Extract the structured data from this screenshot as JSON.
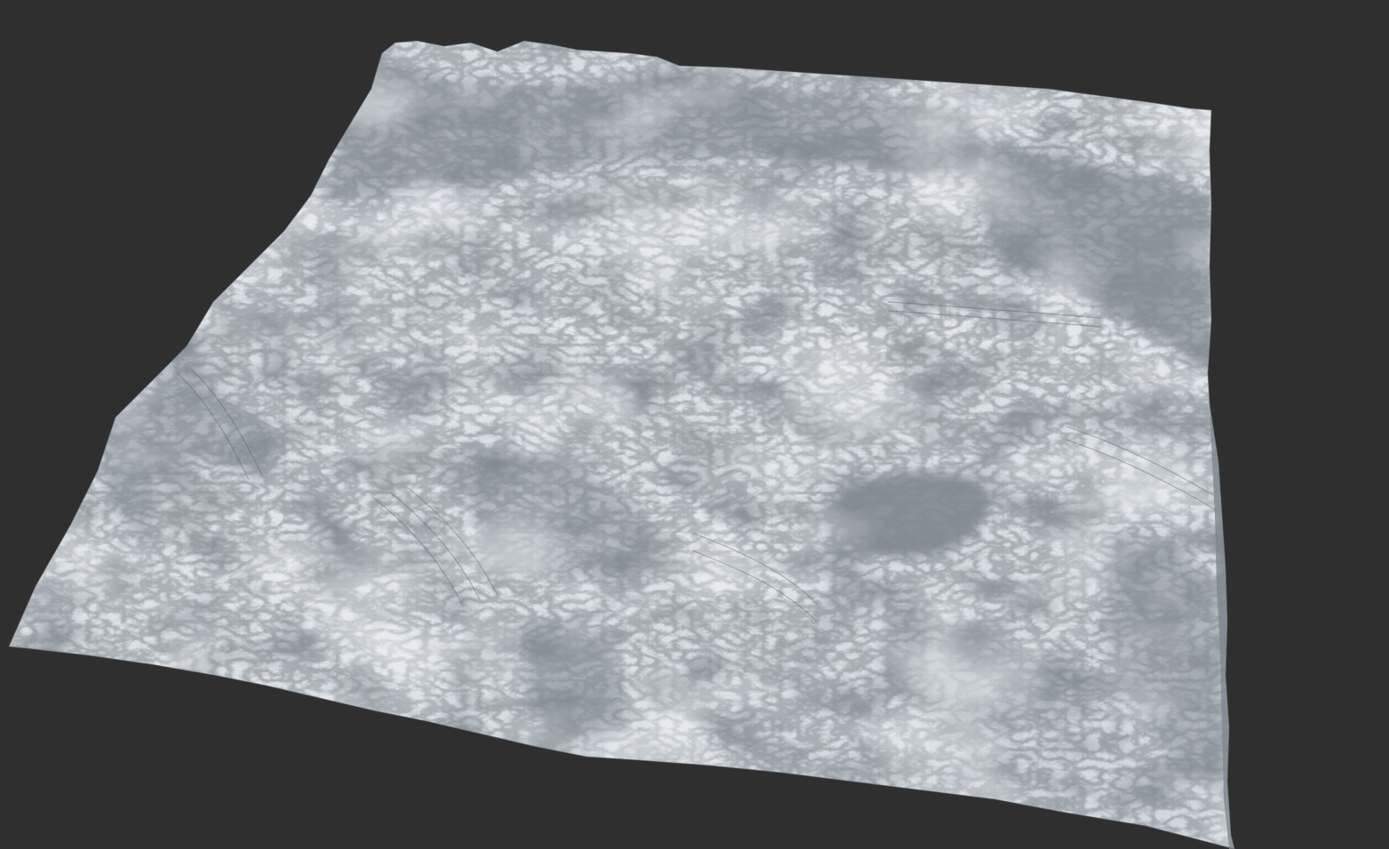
{
  "viewport": {
    "background_color": "#2f2f2f",
    "subject": "terrain-mesh",
    "terrain_colors": {
      "light": "#dfe3e7",
      "mid": "#b9c0c8",
      "dark": "#3a4149"
    }
  }
}
